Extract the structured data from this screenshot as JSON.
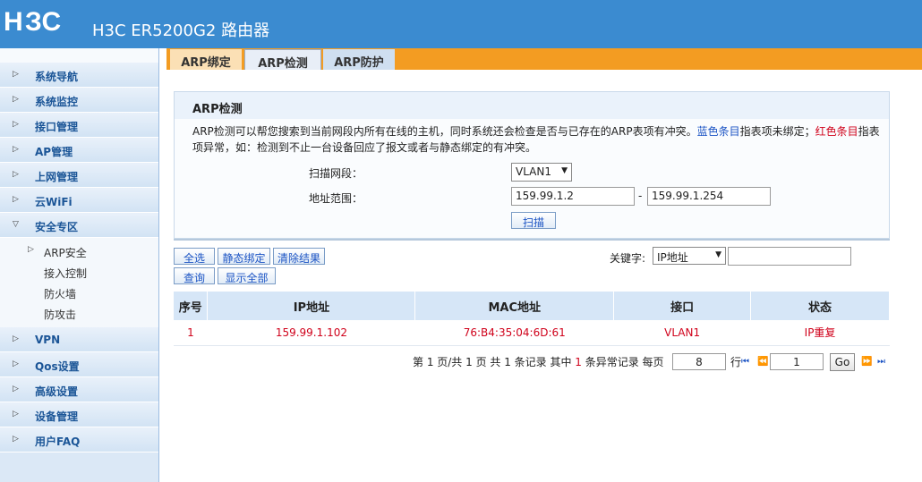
{
  "header": {
    "logo": "H3C",
    "product": "H3C ER5200G2 路由器"
  },
  "sidebar": {
    "items": [
      {
        "label": "系统导航"
      },
      {
        "label": "系统监控"
      },
      {
        "label": "接口管理"
      },
      {
        "label": "AP管理"
      },
      {
        "label": "上网管理"
      },
      {
        "label": "云WiFi"
      },
      {
        "label": "安全专区",
        "expanded": true
      }
    ],
    "sub_items": [
      {
        "label": "ARP安全",
        "active": true
      },
      {
        "label": "接入控制"
      },
      {
        "label": "防火墙"
      },
      {
        "label": "防攻击"
      }
    ],
    "items_after": [
      {
        "label": "VPN"
      },
      {
        "label": "Qos设置"
      },
      {
        "label": "高级设置"
      },
      {
        "label": "设备管理"
      },
      {
        "label": "用户FAQ"
      }
    ]
  },
  "tabs": [
    {
      "label": "ARP绑定"
    },
    {
      "label": "ARP检测",
      "active": true
    },
    {
      "label": "ARP防护"
    }
  ],
  "panel": {
    "title": "ARP检测",
    "desc_part1": "ARP检测可以帮您搜索到当前网段内所有在线的主机，同时系统还会检查是否与已存在的ARP表项有冲突。",
    "desc_blue": "蓝色条目",
    "desc_part2": "指表项未绑定；",
    "desc_red": "红色条目",
    "desc_part3": "指表项异常，如：检测到不止一台设备回应了报文或者与静态绑定的有冲突。",
    "scan_segment_label": "扫描网段：",
    "scan_segment_value": "VLAN1",
    "range_label": "地址范围：",
    "range_start": "159.99.1.2",
    "range_dash": "-",
    "range_end": "159.99.1.254",
    "scan_button": "扫描"
  },
  "toolbar": {
    "select_all": "全选",
    "static_bind": "静态绑定",
    "clear_results": "清除结果",
    "query": "查询",
    "show_all": "显示全部",
    "keyword_label": "关键字:",
    "keyword_field": "IP地址",
    "keyword_value": ""
  },
  "table": {
    "headers": [
      "序号",
      "IP地址",
      "MAC地址",
      "接口",
      "状态"
    ],
    "rows": [
      [
        "1",
        "159.99.1.102",
        "76:B4:35:04:6D:61",
        "VLAN1",
        "IP重复"
      ]
    ]
  },
  "pager": {
    "text_a": "第 1 页/共 1 页 共 1 条记录 其中 ",
    "abnormal_count": "1",
    "text_b": " 条异常记录 每页",
    "per_page": "8",
    "text_c": "行",
    "page_input": "1",
    "go": "Go"
  },
  "colors": {
    "header_bg": "#3b8bd0",
    "tab_bar": "#f39c22",
    "accent_blue": "#1c54c4",
    "alert_red": "#d0021b"
  }
}
